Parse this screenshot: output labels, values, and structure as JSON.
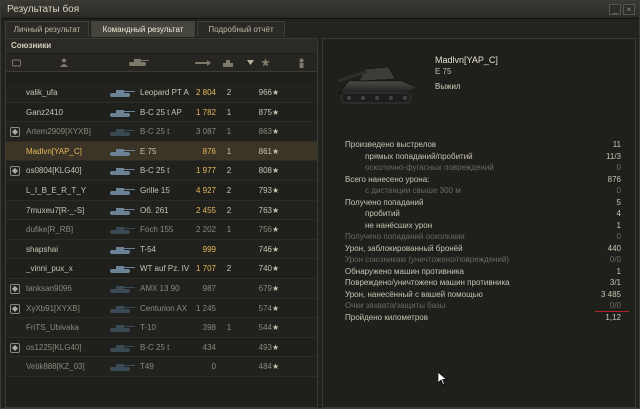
{
  "window": {
    "title": "Результаты боя",
    "minimize": "_",
    "close": "×"
  },
  "tabs": [
    {
      "label": "Личный результат",
      "active": false
    },
    {
      "label": "Командный результат",
      "active": true
    },
    {
      "label": "Подробный отчёт",
      "active": false
    }
  ],
  "allies": {
    "title": "Союзники",
    "columns": [
      "platoon-icon",
      "player-icon",
      "tank-icon",
      "damage-icon",
      "frags-icon",
      "sort-arrow-icon",
      "xp-star-icon",
      "status-icon"
    ],
    "rows": [
      {
        "clan": false,
        "player": "valik_ufa",
        "tank": "Leopard PT A",
        "damage": "2 804",
        "frags": "2",
        "xp": "966",
        "dead": false,
        "me": false
      },
      {
        "clan": false,
        "player": "Ganz2410",
        "tank": "B-C 25 t AP",
        "damage": "1 782",
        "frags": "1",
        "xp": "875",
        "dead": false,
        "me": false
      },
      {
        "clan": true,
        "player": "Artem2909[XYXB]",
        "tank": "B-C 25 t",
        "damage": "3 087",
        "frags": "1",
        "xp": "863",
        "dead": true,
        "me": false
      },
      {
        "clan": false,
        "player": "Madlvn[YAP_C]",
        "tank": "E 75",
        "damage": "876",
        "frags": "1",
        "xp": "861",
        "dead": false,
        "me": true
      },
      {
        "clan": true,
        "player": "os0804[KLG40]",
        "tank": "B-C 25 t",
        "damage": "1 977",
        "frags": "2",
        "xp": "808",
        "dead": false,
        "me": false
      },
      {
        "clan": false,
        "player": "L_I_B_E_R_T_Y",
        "tank": "Grille 15",
        "damage": "4 927",
        "frags": "2",
        "xp": "793",
        "dead": false,
        "me": false
      },
      {
        "clan": false,
        "player": "7muxeu7[R-_-S]",
        "tank": "Об. 261",
        "damage": "2 455",
        "frags": "2",
        "xp": "763",
        "dead": false,
        "me": false
      },
      {
        "clan": false,
        "player": "dufike[R_RB]",
        "tank": "Foch 155",
        "damage": "2 202",
        "frags": "1",
        "xp": "756",
        "dead": true,
        "me": false
      },
      {
        "clan": false,
        "player": "shapshai",
        "tank": "T-54",
        "damage": "999",
        "frags": "",
        "xp": "746",
        "dead": false,
        "me": false
      },
      {
        "clan": false,
        "player": "_vinni_pux_x",
        "tank": "WT auf Pz. IV",
        "damage": "1 707",
        "frags": "2",
        "xp": "740",
        "dead": false,
        "me": false
      },
      {
        "clan": true,
        "player": "tanksan9096",
        "tank": "AMX 13 90",
        "damage": "987",
        "frags": "",
        "xp": "679",
        "dead": true,
        "me": false
      },
      {
        "clan": true,
        "player": "XyXb91[XYXB]",
        "tank": "Centurion AX",
        "damage": "1 245",
        "frags": "",
        "xp": "574",
        "dead": true,
        "me": false
      },
      {
        "clan": false,
        "player": "FriTS_Ubivaka",
        "tank": "T-10",
        "damage": "398",
        "frags": "1",
        "xp": "544",
        "dead": true,
        "me": false
      },
      {
        "clan": true,
        "player": "os1225[KLG40]",
        "tank": "B-C 25 t",
        "damage": "434",
        "frags": "",
        "xp": "493",
        "dead": true,
        "me": false
      },
      {
        "clan": false,
        "player": "Vetik888[KZ_03]",
        "tank": "T49",
        "damage": "0",
        "frags": "",
        "xp": "484",
        "dead": true,
        "me": false
      }
    ]
  },
  "player": {
    "name": "Madlvn[YAP_C]",
    "tank": "E 75",
    "status": "Выжил"
  },
  "stats": [
    {
      "label": "Произведено выстрелов",
      "value": "11",
      "indent": false,
      "faded": false
    },
    {
      "label": "прямых попаданий/пробитий",
      "value": "11/3",
      "indent": true,
      "faded": false
    },
    {
      "label": "осколочно-фугасных повреждений",
      "value": "0",
      "indent": true,
      "faded": true
    },
    {
      "label": "Всего нанесено урона:",
      "value": "876",
      "indent": false,
      "faded": false
    },
    {
      "label": "с дистанции свыше 300 м",
      "value": "0",
      "indent": true,
      "faded": true
    },
    {
      "label": "Получено попаданий",
      "value": "5",
      "indent": false,
      "faded": false
    },
    {
      "label": "пробитий",
      "value": "4",
      "indent": true,
      "faded": false
    },
    {
      "label": "не нанёсших урон",
      "value": "1",
      "indent": true,
      "faded": false
    },
    {
      "label": "Получено попаданий осколками",
      "value": "0",
      "indent": false,
      "faded": true
    },
    {
      "label": "Урон, заблокированный бронёй",
      "value": "440",
      "indent": false,
      "faded": false
    },
    {
      "label": "Урон союзникам (уничтожено/повреждений)",
      "value": "0/0",
      "indent": false,
      "faded": true
    },
    {
      "label": "Обнаружено машин противника",
      "value": "1",
      "indent": false,
      "faded": false
    },
    {
      "label": "Повреждено/уничтожено машин противника",
      "value": "3/1",
      "indent": false,
      "faded": false
    },
    {
      "label": "Урон, нанесённый с вашей помощью",
      "value": "3 485",
      "indent": false,
      "faded": false
    },
    {
      "label": "Очки захвата/защиты базы",
      "value": "0/0",
      "indent": false,
      "faded": true
    },
    {
      "label": "Пройдено километров",
      "value": "1,12",
      "indent": false,
      "faded": false
    }
  ]
}
